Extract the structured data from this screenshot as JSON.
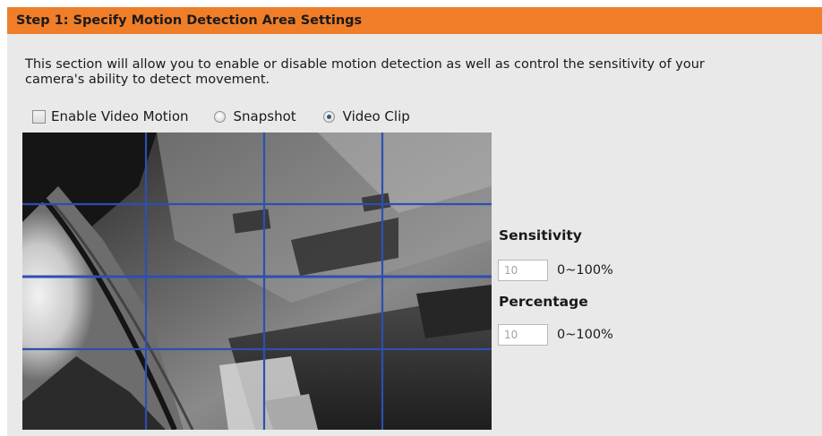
{
  "header": {
    "title": "Step 1: Specify Motion Detection Area Settings"
  },
  "description": {
    "line1": "This section will allow you to enable or disable motion detection as well as control the sensitivity of your",
    "line2": "camera's ability to detect movement."
  },
  "options": {
    "enable_label": "Enable Video Motion",
    "enable_checked": false,
    "snapshot_label": "Snapshot",
    "snapshot_selected": false,
    "videoclip_label": "Video Clip",
    "videoclip_selected": true
  },
  "sensitivity": {
    "label": "Sensitivity",
    "value": "10",
    "range": "0~100%"
  },
  "percentage": {
    "label": "Percentage",
    "value": "10",
    "range": "0~100%"
  },
  "colors": {
    "header_bg": "#f07e28",
    "panel_bg": "#e9e9e9",
    "grid_line": "#2d4fb0"
  }
}
